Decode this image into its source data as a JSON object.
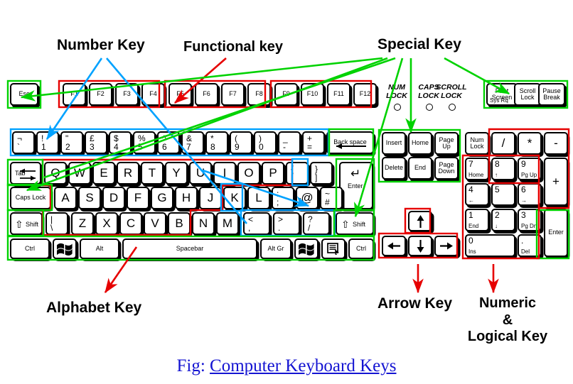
{
  "figure": {
    "caption_prefix": "Fig:",
    "caption_link": "Computer Keyboard Keys",
    "caption_color": "#1414d2"
  },
  "annotations": {
    "number_key": "Number Key",
    "functional_key": "Functional key",
    "special_key": "Special Key",
    "alphabet_key": "Alphabet Key",
    "arrow_key": "Arrow Key",
    "numeric_logical_key": "Numeric\n&\nLogical Key"
  },
  "highlight_colors": {
    "number_key": "#00a2ff",
    "functional_key": "#e60000",
    "special_key": "#00d200",
    "alphabet_key": "#e60000",
    "arrow_key": "#e60000",
    "numeric_key": "#e60000",
    "punctuation": "#00a2ff"
  },
  "indicators": {
    "num_lock": "NUM\nLOCK",
    "caps_lock": "CAPS\nLOCK",
    "scroll_lock": "SCROLL\nLOCK"
  },
  "keys": {
    "esc": "Esc",
    "function_row": [
      "F1",
      "F2",
      "F3",
      "F4",
      "F5",
      "F6",
      "F7",
      "F8",
      "F9",
      "F10",
      "F11",
      "F12"
    ],
    "number_row": [
      {
        "upper": "¬",
        "lower": "`"
      },
      {
        "upper": "!",
        "lower": "1"
      },
      {
        "upper": "\"",
        "lower": "2"
      },
      {
        "upper": "£",
        "lower": "3"
      },
      {
        "upper": "$",
        "lower": "4"
      },
      {
        "upper": "%",
        "lower": "5"
      },
      {
        "upper": "^",
        "lower": "6"
      },
      {
        "upper": "&",
        "lower": "7"
      },
      {
        "upper": "*",
        "lower": "8"
      },
      {
        "upper": "(",
        "lower": "9"
      },
      {
        "upper": ")",
        "lower": "0"
      },
      {
        "upper": "_",
        "lower": "-"
      },
      {
        "upper": "+",
        "lower": "="
      }
    ],
    "backspace": "Back space",
    "tab": "Tab",
    "qwerty_row": [
      "Q",
      "W",
      "E",
      "R",
      "T",
      "Y",
      "U",
      "I",
      "O",
      "P"
    ],
    "bracket_left": {
      "upper": "{",
      "lower": "["
    },
    "bracket_right": {
      "upper": "}",
      "lower": "]"
    },
    "enter": "Enter",
    "caps_lock": "Caps Lock",
    "asdf_row": [
      "A",
      "S",
      "D",
      "F",
      "G",
      "H",
      "J",
      "K",
      "L"
    ],
    "semicolon": {
      "upper": ":",
      "lower": ";"
    },
    "quote": {
      "upper": "@",
      "lower": "'"
    },
    "hash": {
      "upper": "~",
      "lower": "#"
    },
    "shift_left": "Shift",
    "backslash": {
      "upper": "|",
      "lower": "\\"
    },
    "zxcv_row": [
      "Z",
      "X",
      "C",
      "V",
      "B",
      "N",
      "M"
    ],
    "comma": {
      "upper": "<",
      "lower": ","
    },
    "period": {
      "upper": ">",
      "lower": "."
    },
    "slash": {
      "upper": "?",
      "lower": "/"
    },
    "shift_right": "Shift",
    "ctrl_left": "Ctrl",
    "win_left": "windows-logo-icon",
    "alt": "Alt",
    "spacebar": "Spacebar",
    "alt_gr": "Alt Gr",
    "win_right": "windows-logo-icon",
    "menu": "menu-icon",
    "ctrl_right": "Ctrl",
    "print_screen": {
      "main": "Print\nScreen",
      "sub": "Sys Rq"
    },
    "scroll_lock_key": "Scroll\nLock",
    "pause_break": "Pause\nBreak",
    "nav_cluster": [
      "Insert",
      "Home",
      "Page\nUp",
      "Delete",
      "End",
      "Page\nDown"
    ],
    "arrows": {
      "up": "↑",
      "left": "←",
      "down": "↓",
      "right": "→"
    },
    "numpad": {
      "num_lock": "Num\nLock",
      "divide": "/",
      "multiply": "*",
      "minus": "-",
      "plus": "+",
      "enter": "Enter",
      "k7": {
        "num": "7",
        "sub": "Home"
      },
      "k8": {
        "num": "8",
        "sub": "↑"
      },
      "k9": {
        "num": "9",
        "sub": "Pg Up"
      },
      "k4": {
        "num": "4",
        "sub": "←"
      },
      "k5": {
        "num": "5",
        "sub": ""
      },
      "k6": {
        "num": "6",
        "sub": "→"
      },
      "k1": {
        "num": "1",
        "sub": "End"
      },
      "k2": {
        "num": "2",
        "sub": "↓"
      },
      "k3": {
        "num": "3",
        "sub": "Pg Dn"
      },
      "k0": {
        "num": "0",
        "sub": "Ins"
      },
      "kdot": {
        "num": ".",
        "sub": "Del"
      }
    }
  }
}
